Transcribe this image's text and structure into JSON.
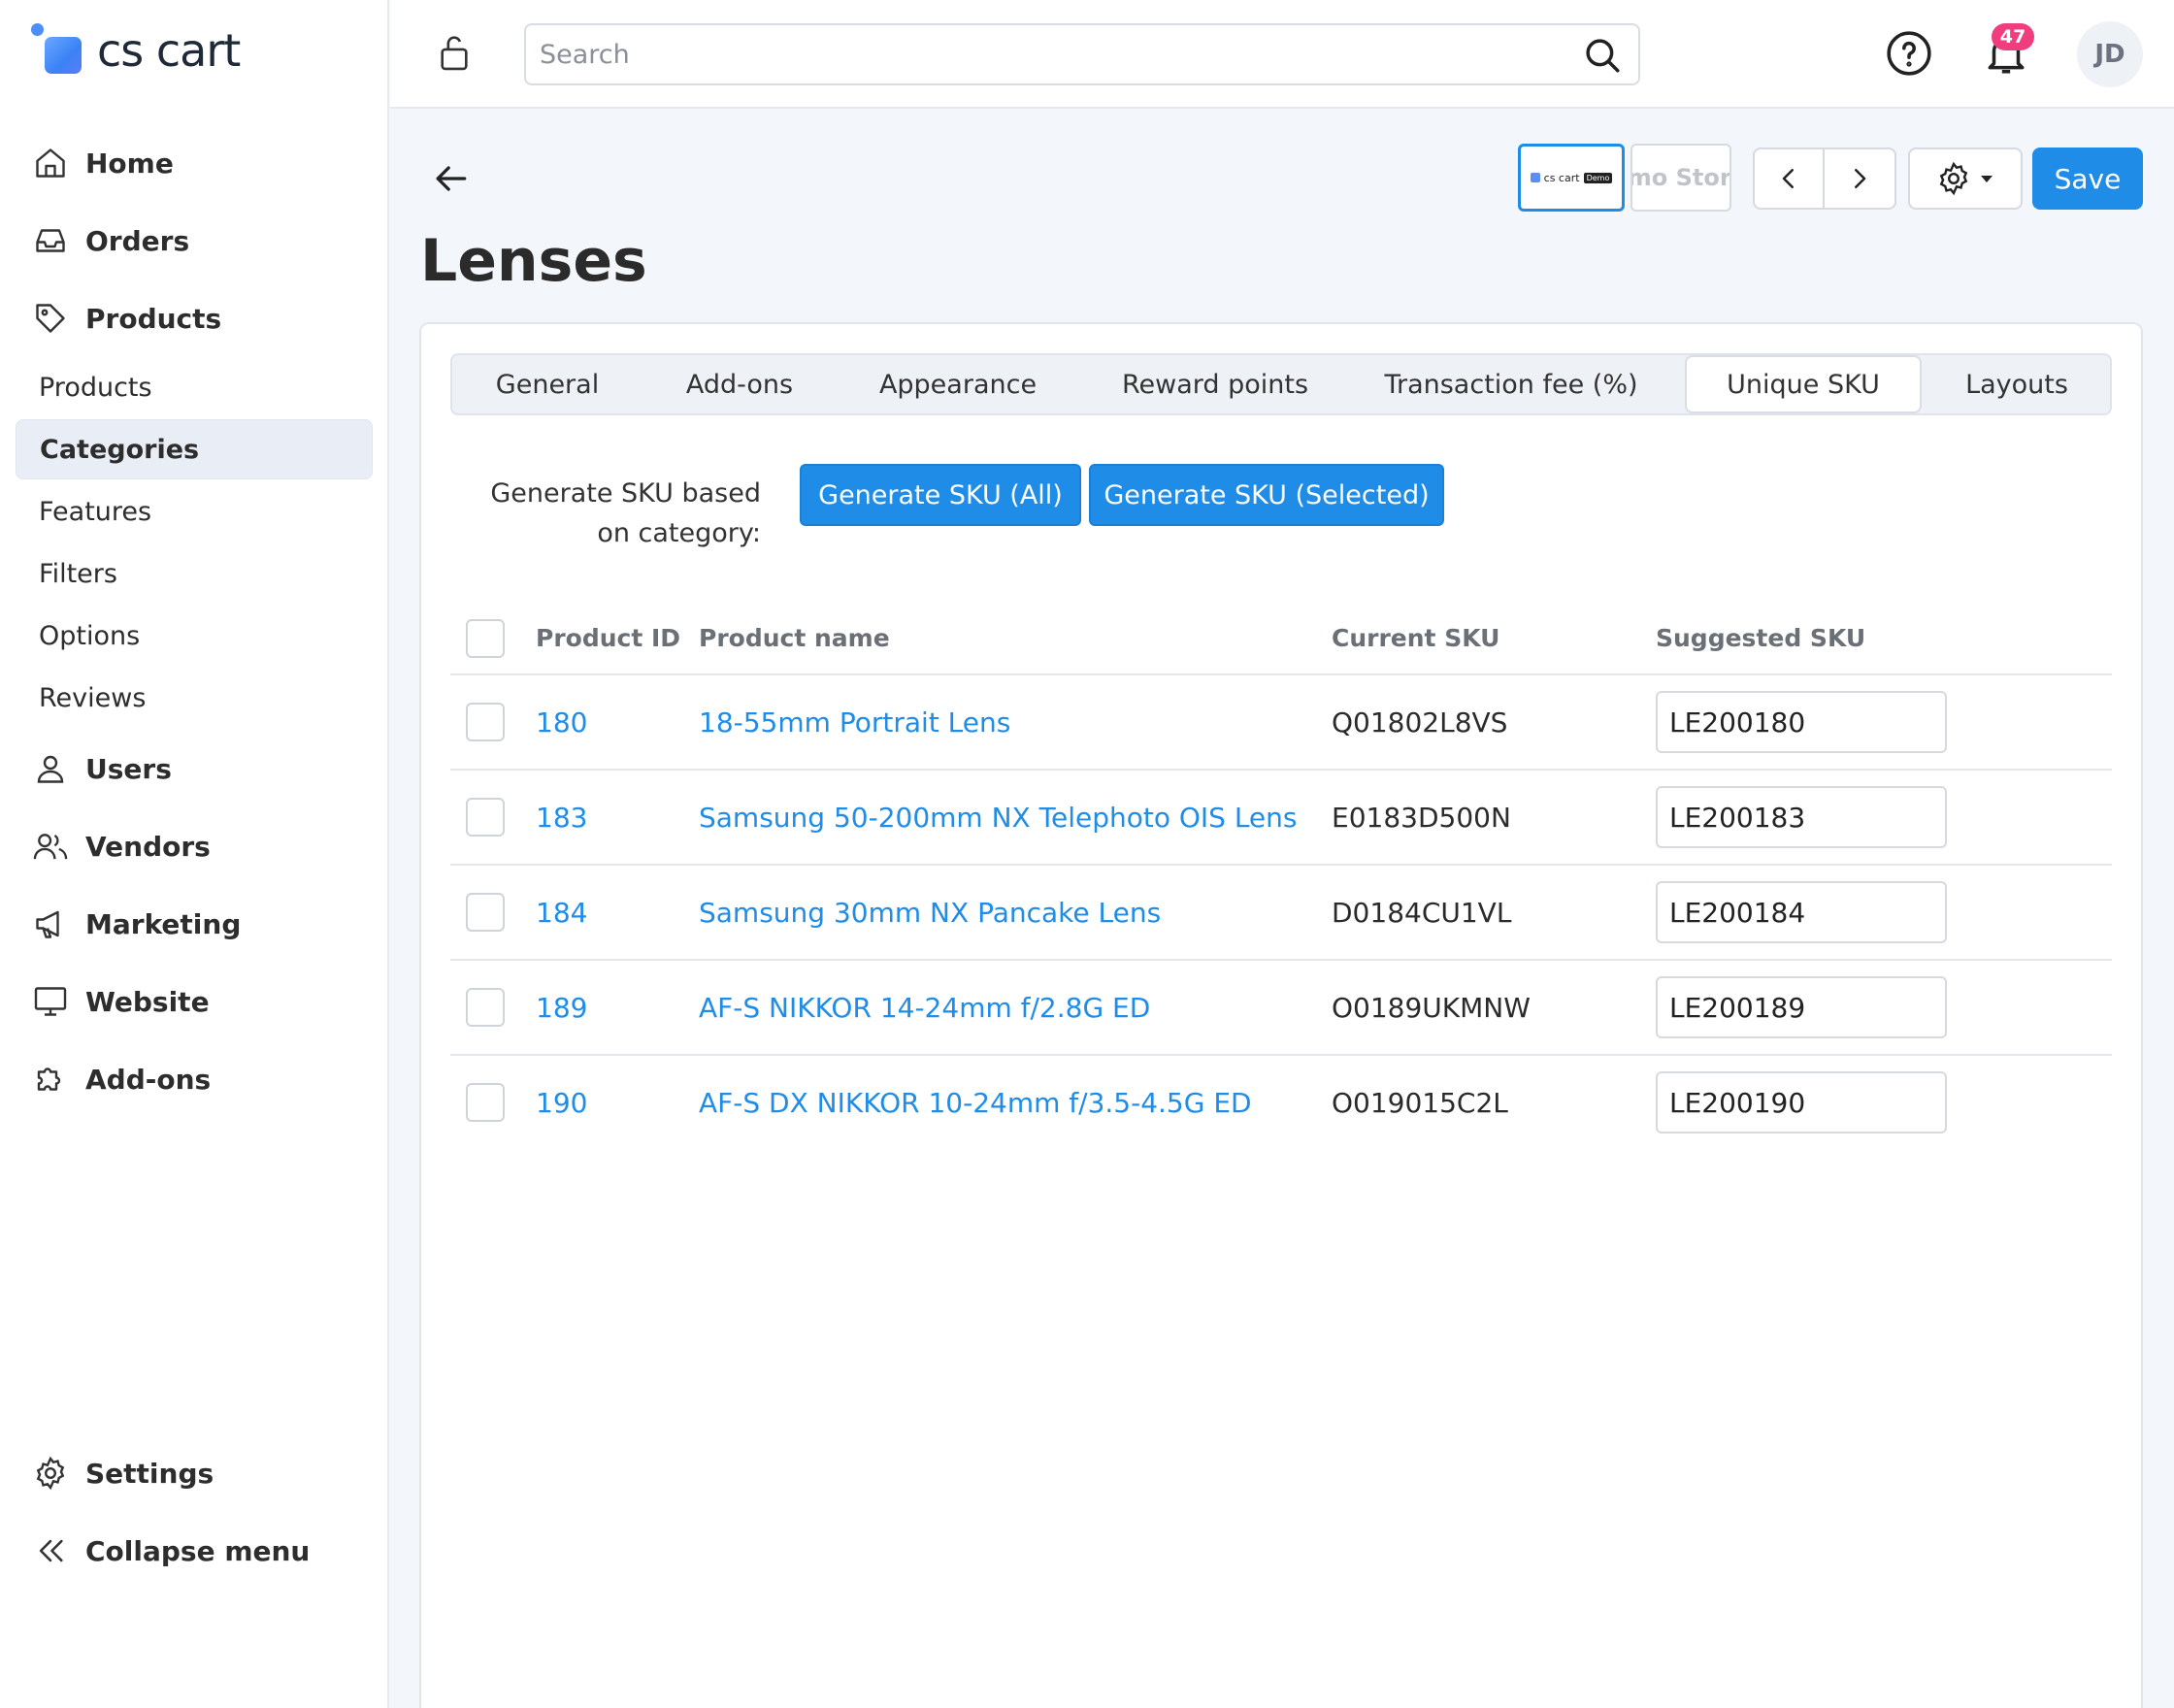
{
  "app": {
    "logo_text": "cs cart",
    "brand_color": "#1f8ce8"
  },
  "topbar": {
    "search_placeholder": "Search",
    "notification_count": "47",
    "avatar_initials": "JD"
  },
  "sidebar": {
    "items": [
      {
        "label": "Home",
        "icon": "home-icon"
      },
      {
        "label": "Orders",
        "icon": "inbox-icon"
      },
      {
        "label": "Products",
        "icon": "tag-icon"
      }
    ],
    "product_sub": [
      "Products",
      "Categories",
      "Features",
      "Filters",
      "Options",
      "Reviews"
    ],
    "active_sub": "Categories",
    "items2": [
      {
        "label": "Users",
        "icon": "user-icon"
      },
      {
        "label": "Vendors",
        "icon": "users-icon"
      },
      {
        "label": "Marketing",
        "icon": "megaphone-icon"
      },
      {
        "label": "Website",
        "icon": "monitor-icon"
      },
      {
        "label": "Add-ons",
        "icon": "puzzle-icon"
      }
    ],
    "bottom": [
      {
        "label": "Settings",
        "icon": "gear-icon"
      },
      {
        "label": "Collapse menu",
        "icon": "double-chevron-left-icon"
      }
    ]
  },
  "header": {
    "title": "Lenses",
    "store_thumb_text": "cs cart",
    "store_thumb_tag": "Demo",
    "store2_text": "Demo Store",
    "save_label": "Save"
  },
  "tabs": [
    {
      "label": "General"
    },
    {
      "label": "Add-ons"
    },
    {
      "label": "Appearance"
    },
    {
      "label": "Reward points"
    },
    {
      "label": "Transaction fee (%)"
    },
    {
      "label": "Unique SKU",
      "active": true
    },
    {
      "label": "Layouts"
    }
  ],
  "sku_tool": {
    "label": "Generate SKU based on category:",
    "btn_all": "Generate SKU (All)",
    "btn_selected": "Generate SKU (Selected)"
  },
  "table": {
    "columns": [
      "Product ID",
      "Product name",
      "Current SKU",
      "Suggested SKU"
    ],
    "rows": [
      {
        "id": "180",
        "name": "18-55mm Portrait Lens",
        "current_sku": "Q01802L8VS",
        "suggested_sku": "LE200180"
      },
      {
        "id": "183",
        "name": "Samsung 50-200mm NX Telephoto OIS Lens",
        "current_sku": "E0183D500N",
        "suggested_sku": "LE200183"
      },
      {
        "id": "184",
        "name": "Samsung 30mm NX Pancake Lens",
        "current_sku": "D0184CU1VL",
        "suggested_sku": "LE200184"
      },
      {
        "id": "189",
        "name": "AF-S NIKKOR 14-24mm f/2.8G ED",
        "current_sku": "O0189UKMNW",
        "suggested_sku": "LE200189"
      },
      {
        "id": "190",
        "name": "AF-S DX NIKKOR 10-24mm f/3.5-4.5G ED",
        "current_sku": "O019015C2L",
        "suggested_sku": "LE200190"
      }
    ]
  }
}
